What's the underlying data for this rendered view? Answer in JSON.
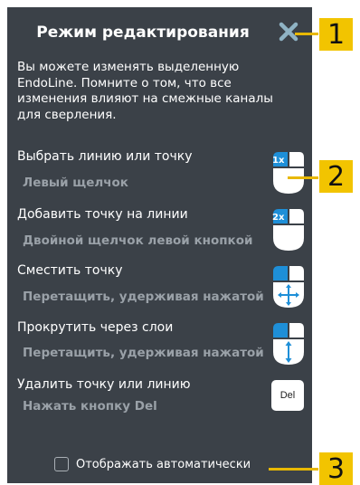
{
  "panel": {
    "title": "Режим редактирования",
    "intro": "Вы можете изменять выделенную EndoLine. Помните о том, что все изменения влияют на смежные каналы для сверления.",
    "actions": [
      {
        "label": "Выбрать линию или точку",
        "hint": "Левый щелчок",
        "icon": "mouse-left-click-icon",
        "badge": "1x"
      },
      {
        "label": "Добавить точку на линии",
        "hint": "Двойной щелчок левой кнопкой",
        "icon": "mouse-double-click-icon",
        "badge": "2x"
      },
      {
        "label": "Сместить точку",
        "hint": "Перетащить, удерживая нажатой",
        "icon": "mouse-drag-move-icon"
      },
      {
        "label": "Прокрутить через слои",
        "hint": "Перетащить, удерживая нажатой",
        "icon": "mouse-drag-scroll-icon"
      },
      {
        "label": "Удалить точку или линию",
        "hint": "Нажать кнопку Del",
        "icon": "delete-key-icon",
        "key": "Del"
      }
    ],
    "auto_show_label": "Отображать автоматически",
    "auto_show_checked": false
  },
  "callouts": [
    "1",
    "2",
    "3"
  ],
  "colors": {
    "panel_bg": "#3b4148",
    "accent_blue": "#1e8fd8",
    "callout_yellow": "#f2c400",
    "hint_gray": "#9aa1a8"
  }
}
